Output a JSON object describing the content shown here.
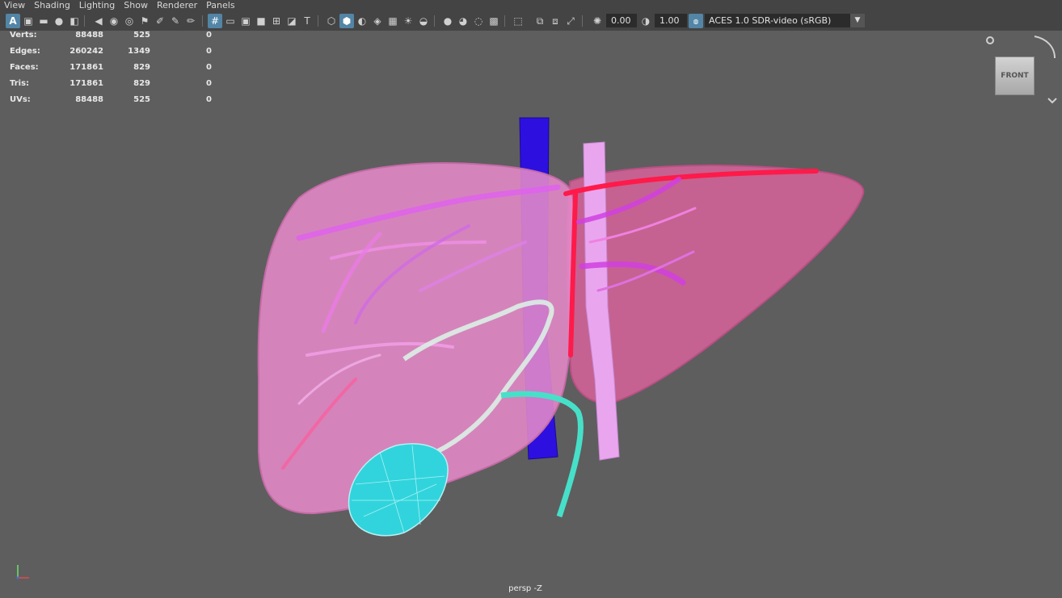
{
  "menu": [
    "View",
    "Shading",
    "Lighting",
    "Show",
    "Renderer",
    "Panels"
  ],
  "toolbar": {
    "exposure_value": "0.00",
    "gamma_value": "1.00",
    "color_space": "ACES 1.0 SDR-video (sRGB)"
  },
  "hud": {
    "rows": [
      {
        "label": "Verts:",
        "c1": "88488",
        "c2": "525",
        "c3": "0"
      },
      {
        "label": "Edges:",
        "c1": "260242",
        "c2": "1349",
        "c3": "0"
      },
      {
        "label": "Faces:",
        "c1": "171861",
        "c2": "829",
        "c3": "0"
      },
      {
        "label": "Tris:",
        "c1": "171861",
        "c2": "829",
        "c3": "0"
      },
      {
        "label": "UVs:",
        "c1": "88488",
        "c2": "525",
        "c3": "0"
      }
    ]
  },
  "viewcube": {
    "face": "FRONT"
  },
  "camera_label": "persp -Z",
  "colors": {
    "viewport_bg": "#5e5e5e",
    "liver": "#e58ac8",
    "ivc": "#2d10e0",
    "portal_vein": "#e9a6ef",
    "artery": "#ff1a4a",
    "bile_duct": "#46e0c9",
    "gallbladder": "#31d4dc"
  },
  "icons": [
    "select-tool-icon",
    "camera-icon",
    "grid-icon",
    "wireframe-icon",
    "shaded-icon",
    "textured-icon",
    "light-icon",
    "isolate-icon",
    "exposure-icon",
    "gamma-icon",
    "color-management-icon",
    "axis-gizmo-icon"
  ]
}
